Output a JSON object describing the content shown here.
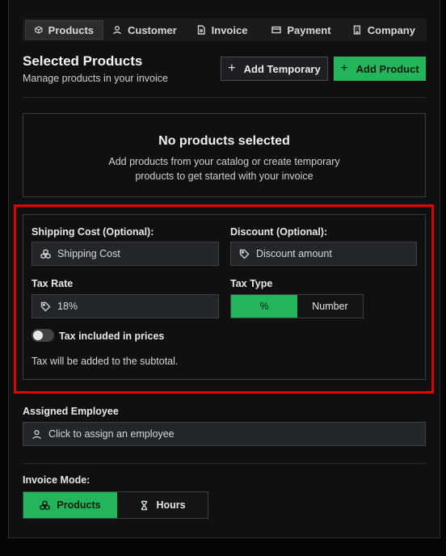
{
  "tabs": [
    {
      "label": "Products",
      "icon": "box-icon",
      "active": true
    },
    {
      "label": "Customer",
      "icon": "user-icon"
    },
    {
      "label": "Invoice",
      "icon": "file-icon"
    },
    {
      "label": "Payment",
      "icon": "credit-card-icon"
    },
    {
      "label": "Company",
      "icon": "building-icon"
    }
  ],
  "header": {
    "title": "Selected Products",
    "subtitle": "Manage products in your invoice",
    "add_temporary_label": "Add Temporary",
    "add_product_label": "Add Product"
  },
  "empty_state": {
    "title": "No products selected",
    "description": "Add products from your catalog or create temporary products to get started with your invoice"
  },
  "tax_section": {
    "shipping_label": "Shipping Cost (Optional):",
    "shipping_placeholder": "Shipping Cost",
    "discount_label": "Discount (Optional):",
    "discount_placeholder": "Discount amount",
    "tax_rate_label": "Tax Rate",
    "tax_rate_value": "18%",
    "tax_type_label": "Tax Type",
    "tax_type_options": [
      "%",
      "Number"
    ],
    "tax_type_selected": "%",
    "tax_included_label": "Tax included in prices",
    "tax_included": false,
    "note": "Tax will be added to the subtotal."
  },
  "employee": {
    "label": "Assigned Employee",
    "placeholder": "Click to assign an employee"
  },
  "invoice_mode": {
    "label": "Invoice Mode:",
    "options": [
      "Products",
      "Hours"
    ],
    "selected": "Products"
  },
  "colors": {
    "accent": "#22b55a",
    "highlight": "#e00000",
    "background": "#101010"
  }
}
